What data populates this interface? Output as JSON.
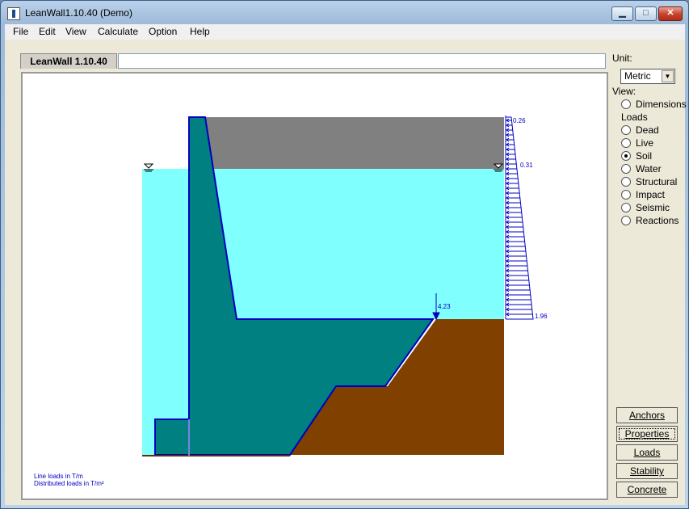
{
  "window": {
    "title": "LeanWall1.10.40 (Demo)",
    "min_glyph": "▁",
    "max_glyph": "□",
    "close_glyph": "✕"
  },
  "menu": [
    "File",
    "Edit",
    "View",
    "Calculate",
    "Option",
    "Help"
  ],
  "tab": {
    "label": "LeanWall 1.10.40"
  },
  "title_field": {
    "value": ""
  },
  "sidebar": {
    "unit_label": "Unit:",
    "unit_value": "Metric",
    "view_label": "View:",
    "loads_label": "Loads",
    "options": [
      {
        "label": "Dimensions",
        "selected": false
      },
      {
        "label": "Dead",
        "selected": false
      },
      {
        "label": "Live",
        "selected": false
      },
      {
        "label": "Soil",
        "selected": true
      },
      {
        "label": "Water",
        "selected": false
      },
      {
        "label": "Structural",
        "selected": false
      },
      {
        "label": "Impact",
        "selected": false
      },
      {
        "label": "Seismic",
        "selected": false
      },
      {
        "label": "Reactions",
        "selected": false
      }
    ],
    "buttons": [
      "Anchors",
      "Properties",
      "Loads",
      "Stability",
      "Concrete"
    ],
    "focused_button": "Properties"
  },
  "drawing": {
    "load_labels": {
      "top": "0.26",
      "water": "0.31",
      "bottom": "1.96",
      "point_load": "4.23"
    },
    "notes": [
      "Line loads in T/m",
      "Distributed loads in T/m²"
    ],
    "colors": {
      "water": "#80ffff",
      "backfill": "#808080",
      "wall": "#008080",
      "foundation": "#804000",
      "outline": "#0000c0"
    }
  }
}
